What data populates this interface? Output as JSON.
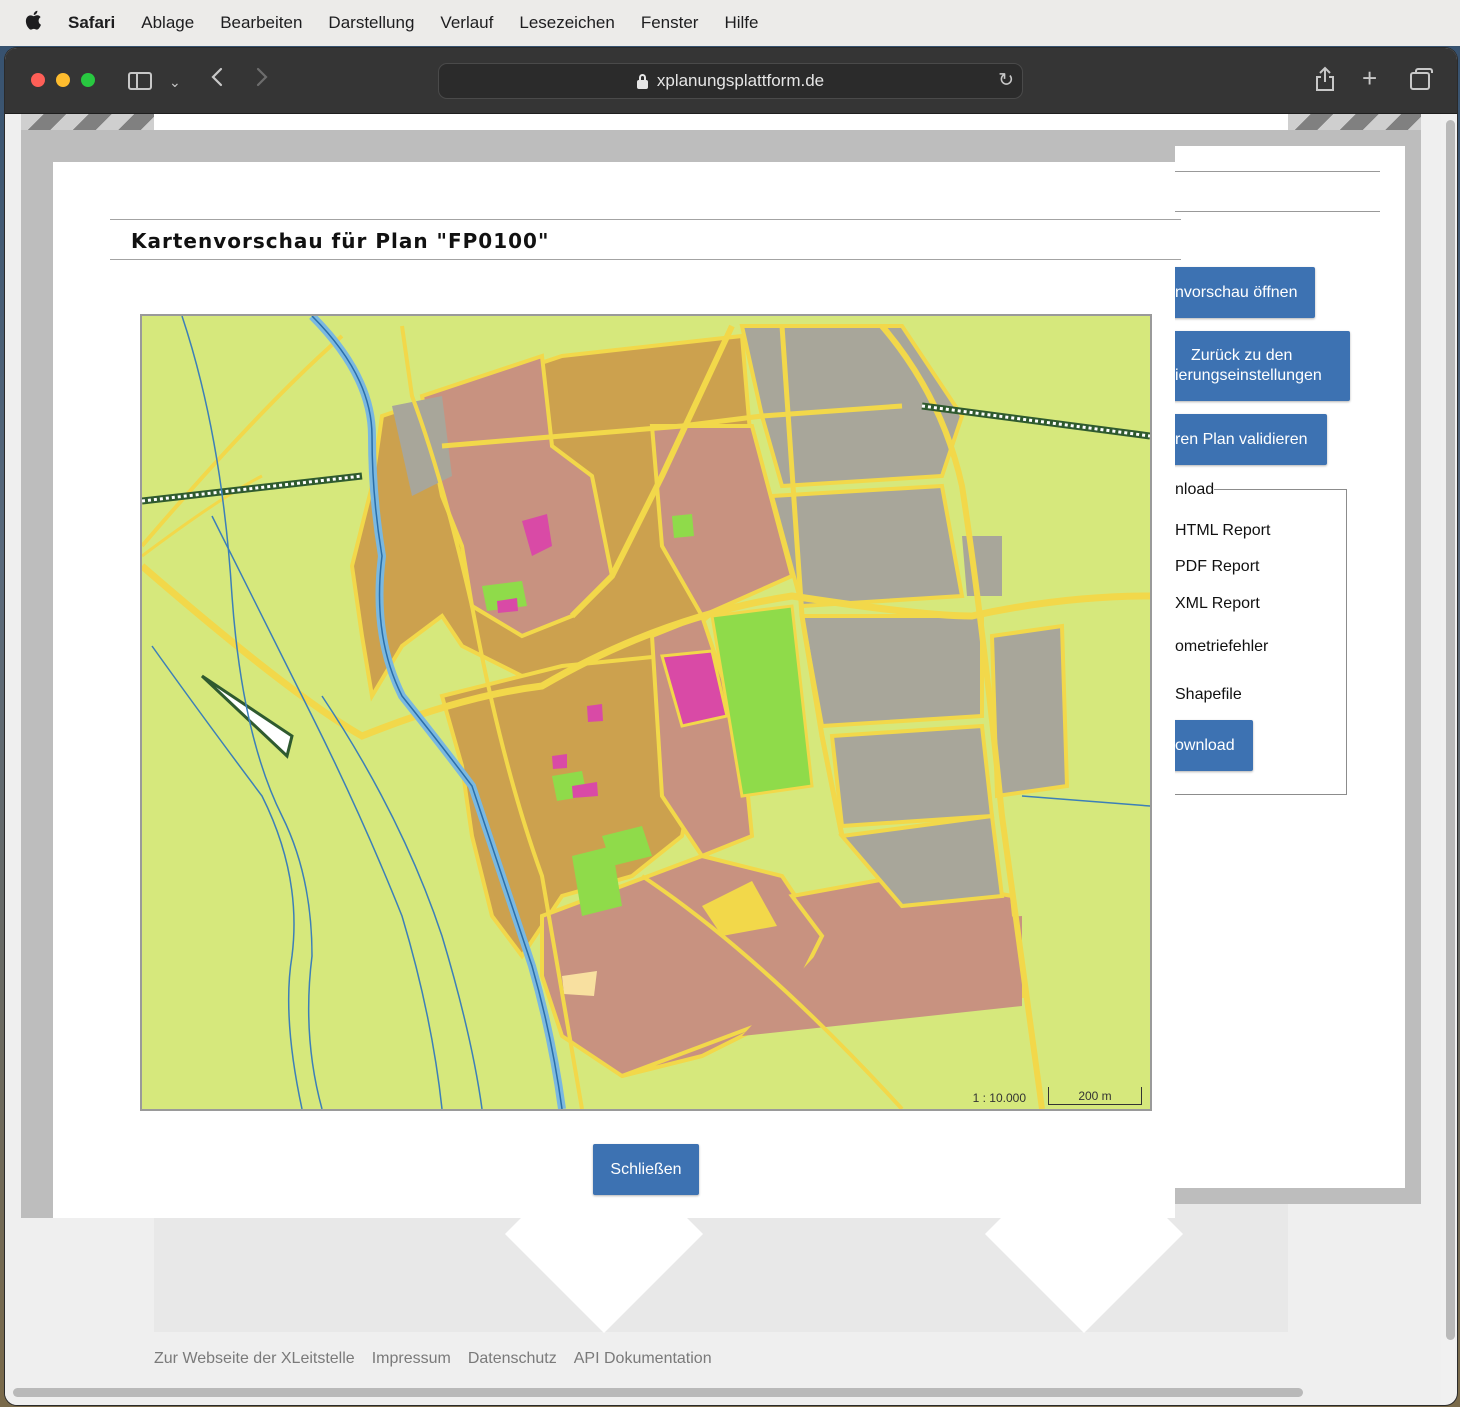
{
  "menubar": {
    "app": "Safari",
    "items": [
      "Ablage",
      "Bearbeiten",
      "Darstellung",
      "Verlauf",
      "Lesezeichen",
      "Fenster",
      "Hilfe"
    ]
  },
  "browser": {
    "url": "xplanungsplattform.de"
  },
  "underlying": {
    "buttons": {
      "preview": "nvorschau öffnen",
      "back_line1": "Zurück zu den",
      "back_line2": "ierungseinstellungen",
      "validate": "ren Plan validieren",
      "download": "ownload"
    },
    "download_legend": "nload",
    "options": [
      "HTML Report",
      "PDF Report",
      "XML Report",
      "ometriefehler",
      "Shapefile"
    ]
  },
  "modal": {
    "title": "Kartenvorschau für Plan \"FP0100\"",
    "scale_ratio": "1 : 10.000",
    "scale_bar": "200 m",
    "close_label": "Schließen"
  },
  "footer": {
    "links": [
      "Zur Webseite der XLeitstelle",
      "Impressum",
      "Datenschutz",
      "API Dokumentation"
    ]
  },
  "colors": {
    "button": "#3d72b2",
    "map_background": "#d6e87c",
    "residential": "#c89280",
    "mixed": "#cca14e",
    "commercial": "#a8a69a",
    "green": "#8fdb4a",
    "special": "#d94aa6",
    "road": "#f2d84a",
    "water": "#7ab8e0"
  }
}
